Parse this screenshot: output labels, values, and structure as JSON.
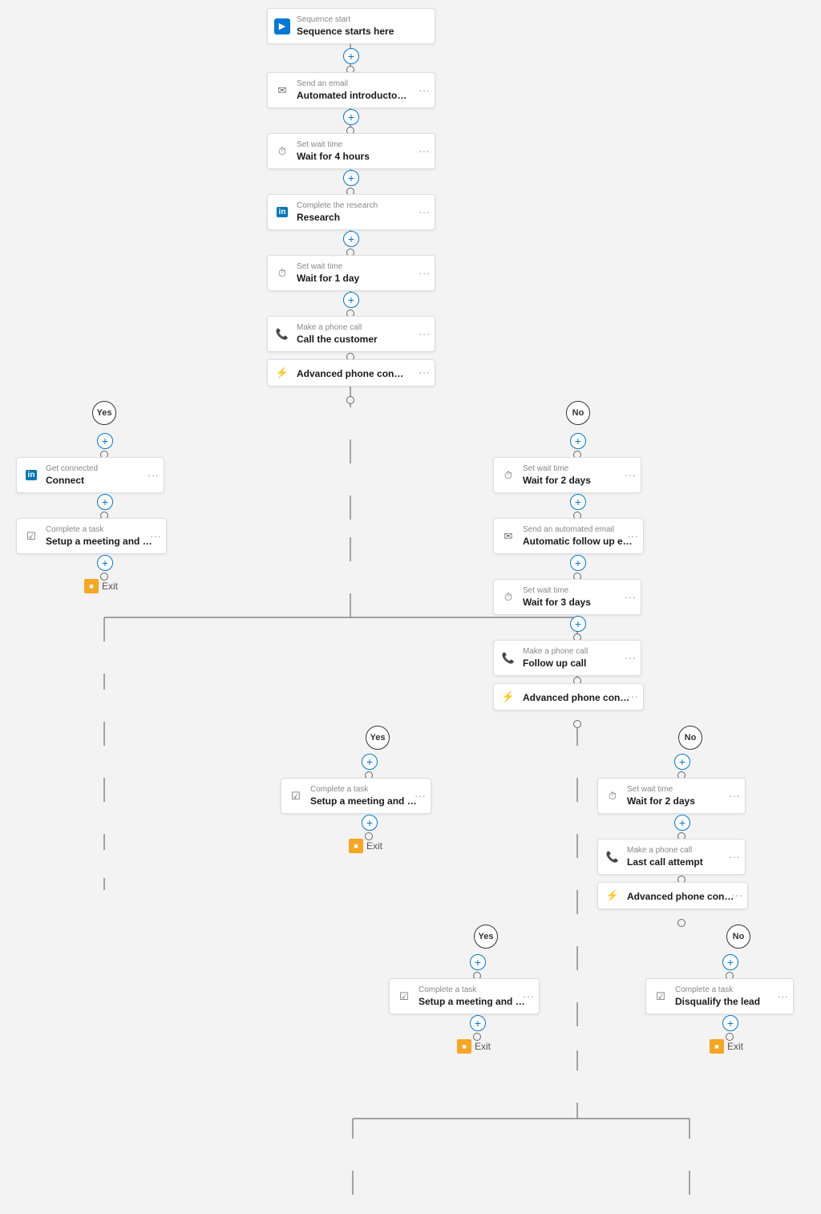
{
  "nodes": {
    "sequence_start": {
      "label": "Sequence start",
      "title": "Sequence starts here"
    },
    "send_email_1": {
      "label": "Send an email",
      "title": "Automated introductory email"
    },
    "wait_4h": {
      "label": "Set wait time",
      "title": "Wait for 4 hours"
    },
    "research": {
      "label": "Complete the research",
      "title": "Research"
    },
    "wait_1d": {
      "label": "Set wait time",
      "title": "Wait for 1 day"
    },
    "call_customer": {
      "label": "Make a phone call",
      "title": "Call the customer"
    },
    "phone_condition_1": {
      "label": "",
      "title": "Advanced phone condition"
    },
    "connect": {
      "label": "Get connected",
      "title": "Connect"
    },
    "setup_meeting_1": {
      "label": "Complete a task",
      "title": "Setup a meeting and move to the next s..."
    },
    "exit_1": {
      "label": "Exit",
      "title": "Exit"
    },
    "wait_2d_1": {
      "label": "Set wait time",
      "title": "Wait for 2 days"
    },
    "auto_follow_email": {
      "label": "Send an automated email",
      "title": "Automatic follow up email"
    },
    "wait_3d": {
      "label": "Set wait time",
      "title": "Wait for 3 days"
    },
    "follow_up_call": {
      "label": "Make a phone call",
      "title": "Follow up call"
    },
    "phone_condition_2": {
      "label": "",
      "title": "Advanced phone condition"
    },
    "setup_meeting_2": {
      "label": "Complete a task",
      "title": "Setup a meeting and move to the next s..."
    },
    "exit_2": {
      "label": "Exit",
      "title": "Exit"
    },
    "wait_2d_2": {
      "label": "Set wait time",
      "title": "Wait for 2 days"
    },
    "last_call": {
      "label": "Make a phone call",
      "title": "Last call attempt"
    },
    "phone_condition_3": {
      "label": "",
      "title": "Advanced phone condition"
    },
    "setup_meeting_3": {
      "label": "Complete a task",
      "title": "Setup a meeting and move to the next s..."
    },
    "disqualify": {
      "label": "Complete a task",
      "title": "Disqualify the lead"
    },
    "exit_3": {
      "label": "Exit",
      "title": "Exit"
    },
    "exit_4": {
      "label": "Exit",
      "title": "Exit"
    }
  },
  "branch_labels": {
    "yes": "Yes",
    "no": "No"
  },
  "icons": {
    "sequence": "▶",
    "email": "✉",
    "wait": "⏱",
    "task": "✓",
    "phone": "📞",
    "condition": "🔀",
    "linkedin": "in",
    "exit": "⬛",
    "dots": "⋯"
  },
  "colors": {
    "blue": "#0078d4",
    "orange": "#f5a623",
    "gray": "#888",
    "border": "#ddd",
    "bg": "#f3f3f3",
    "white": "#fff"
  }
}
